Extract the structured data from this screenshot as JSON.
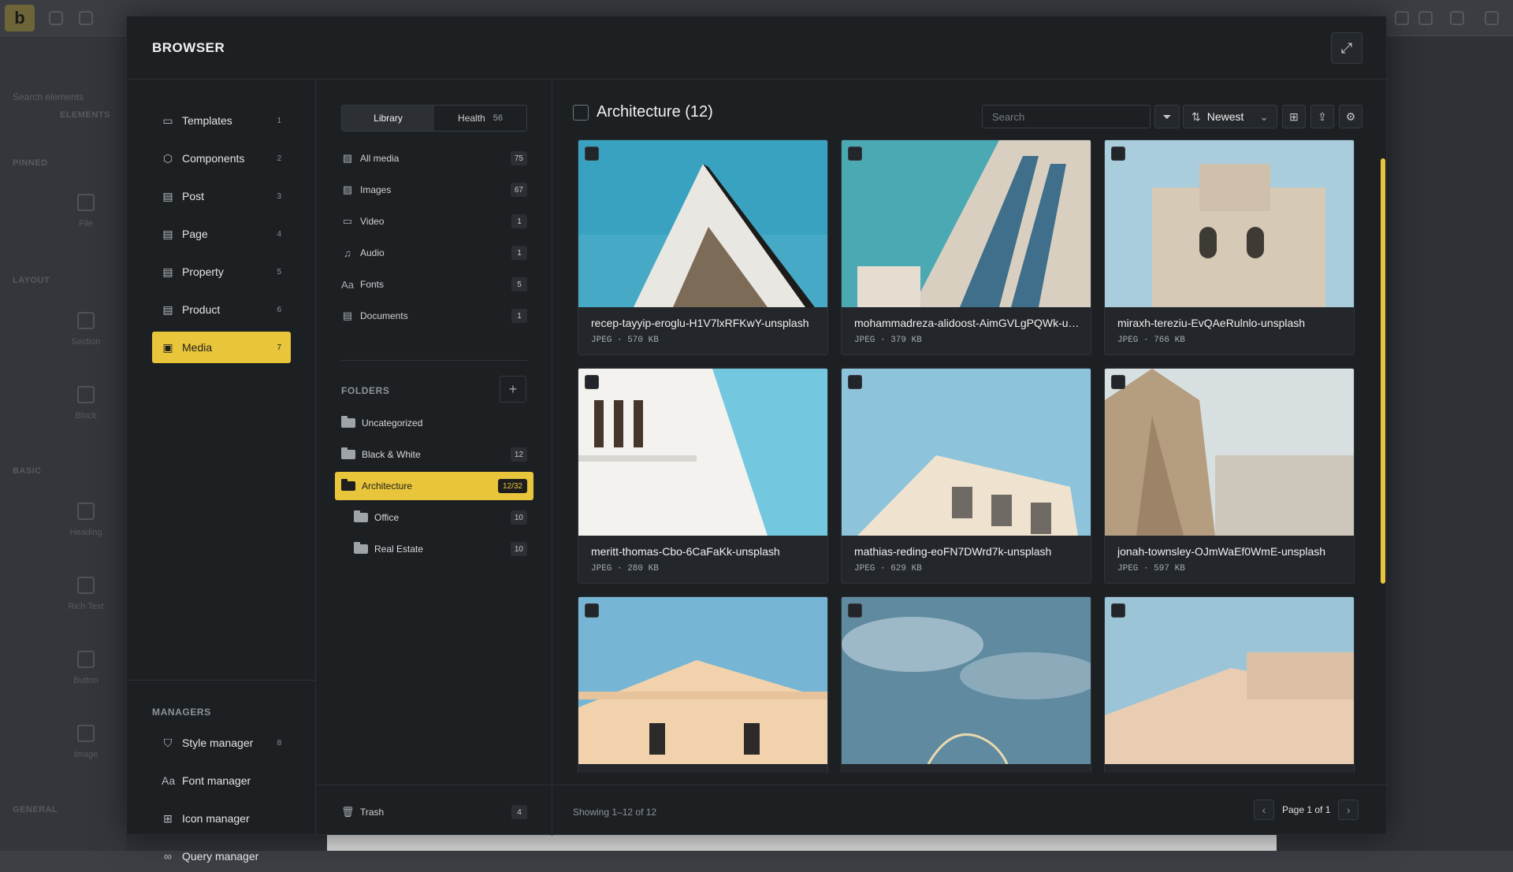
{
  "background": {
    "logo": "b",
    "search_placeholder": "Search elements",
    "sections": [
      "ELEMENTS",
      "PINNED",
      "LAYOUT",
      "BASIC",
      "GENERAL"
    ],
    "elements": [
      "File",
      "Section",
      "Block",
      "Heading",
      "Rich Text",
      "Button",
      "Image"
    ]
  },
  "modal": {
    "title": "BROWSER",
    "expand_icon": "expand-icon"
  },
  "nav": {
    "items": [
      {
        "label": "Templates",
        "count": "1",
        "icon": "template-icon"
      },
      {
        "label": "Components",
        "count": "2",
        "icon": "cube-icon"
      },
      {
        "label": "Post",
        "count": "3",
        "icon": "doc-icon"
      },
      {
        "label": "Page",
        "count": "4",
        "icon": "doc-icon"
      },
      {
        "label": "Property",
        "count": "5",
        "icon": "doc-icon"
      },
      {
        "label": "Product",
        "count": "6",
        "icon": "doc-icon"
      },
      {
        "label": "Media",
        "count": "7",
        "icon": "image-icon",
        "active": true
      }
    ],
    "managers_label": "MANAGERS",
    "managers": [
      {
        "label": "Style manager",
        "count": "8"
      },
      {
        "label": "Font manager",
        "count": ""
      },
      {
        "label": "Icon manager",
        "count": ""
      },
      {
        "label": "Query manager",
        "count": ""
      }
    ]
  },
  "library": {
    "tabs": [
      {
        "label": "Library",
        "count": ""
      },
      {
        "label": "Health",
        "count": "56"
      }
    ],
    "items": [
      {
        "label": "All media",
        "count": "75"
      },
      {
        "label": "Images",
        "count": "67"
      },
      {
        "label": "Video",
        "count": "1"
      },
      {
        "label": "Audio",
        "count": "1"
      },
      {
        "label": "Fonts",
        "count": "5"
      },
      {
        "label": "Documents",
        "count": "1"
      }
    ],
    "folders_label": "FOLDERS",
    "folders": [
      {
        "label": "Uncategorized",
        "count": ""
      },
      {
        "label": "Black & White",
        "count": "12"
      },
      {
        "label": "Architecture",
        "count": "12/32",
        "active": true
      },
      {
        "label": "Office",
        "count": "10"
      },
      {
        "label": "Real Estate",
        "count": "10"
      }
    ],
    "trash": {
      "label": "Trash",
      "count": "4"
    }
  },
  "main": {
    "title": "Architecture (12)",
    "search_placeholder": "Search",
    "sort_label": "Newest",
    "cards": [
      {
        "name": "recep-tayyip-eroglu-H1V7lxRFKwY-unsplash",
        "meta": "JPEG ·  570 KB"
      },
      {
        "name": "mohammadreza-alidoost-AimGVLgPQWk-unsplash",
        "meta": "JPEG ·  379 KB"
      },
      {
        "name": "miraxh-tereziu-EvQAeRulnlo-unsplash",
        "meta": "JPEG ·  766 KB"
      },
      {
        "name": "meritt-thomas-Cbo-6CaFaKk-unsplash",
        "meta": "JPEG ·  280 KB"
      },
      {
        "name": "mathias-reding-eoFN7DWrd7k-unsplash",
        "meta": "JPEG ·  629 KB"
      },
      {
        "name": "jonah-townsley-OJmWaEf0WmE-unsplash",
        "meta": "JPEG ·  597 KB"
      },
      {
        "name": "",
        "meta": ""
      },
      {
        "name": "",
        "meta": ""
      },
      {
        "name": "",
        "meta": ""
      }
    ],
    "showing": "Showing 1–12 of 12",
    "page": "Page 1 of 1"
  },
  "colors": {
    "accent": "#e8c53a",
    "panel": "#1d2023"
  }
}
